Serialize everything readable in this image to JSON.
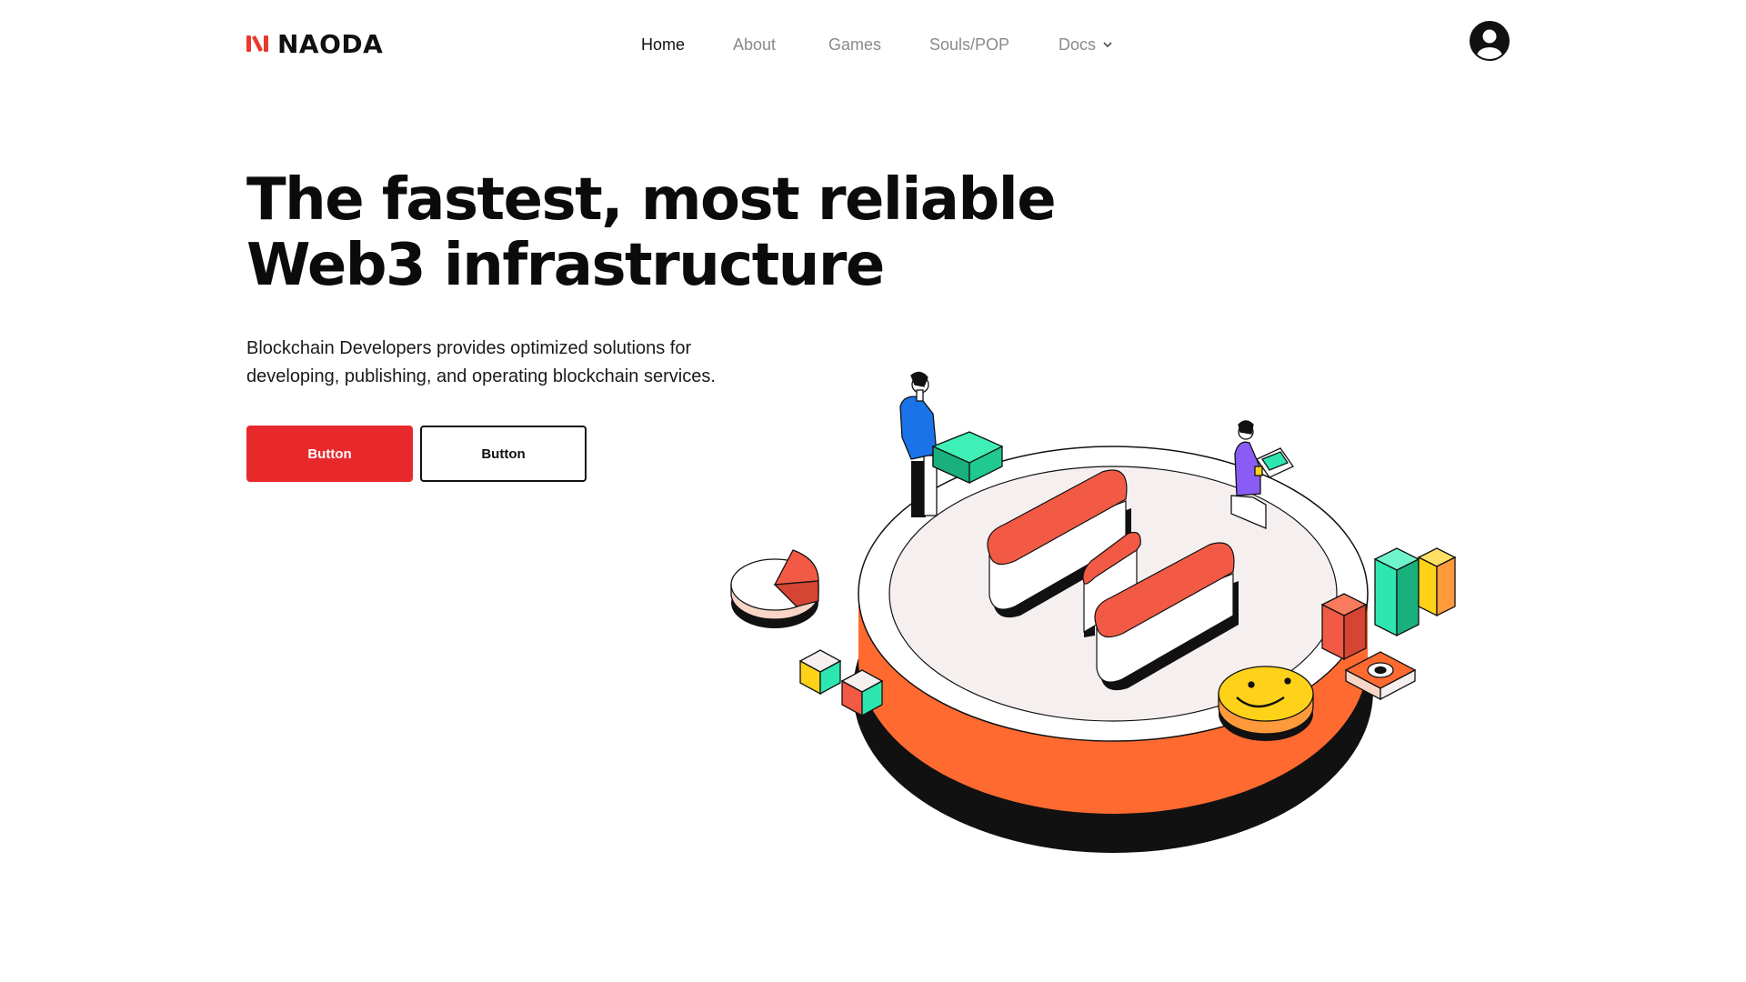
{
  "brand": {
    "name": "NAODA",
    "accent_color": "#e8392c"
  },
  "nav": {
    "items": [
      {
        "label": "Home",
        "active": true
      },
      {
        "label": "About",
        "active": false
      },
      {
        "label": "Games",
        "active": false
      },
      {
        "label": "Souls/POP",
        "active": false
      },
      {
        "label": "Docs",
        "active": false,
        "has_dropdown": true
      }
    ]
  },
  "header": {
    "account_icon": "user-circle-icon"
  },
  "hero": {
    "title_line1": "The fastest, most reliable",
    "title_line2": "Web3 infrastructure",
    "subtitle_line1": "Blockchain Developers provides optimized solutions for",
    "subtitle_line2": "developing, publishing, and operating blockchain services.",
    "primary_button": "Button",
    "secondary_button": "Button",
    "primary_color": "#e8292c"
  },
  "illustration": {
    "description_icon": "isometric-platform-illustration",
    "colors": {
      "platform_side": "#ff6a30",
      "logo_top": "#f25a45",
      "green": "#2ee6b0",
      "yellow": "#ffd21a",
      "purple": "#8a5cf6",
      "blue": "#1a73e8"
    }
  }
}
